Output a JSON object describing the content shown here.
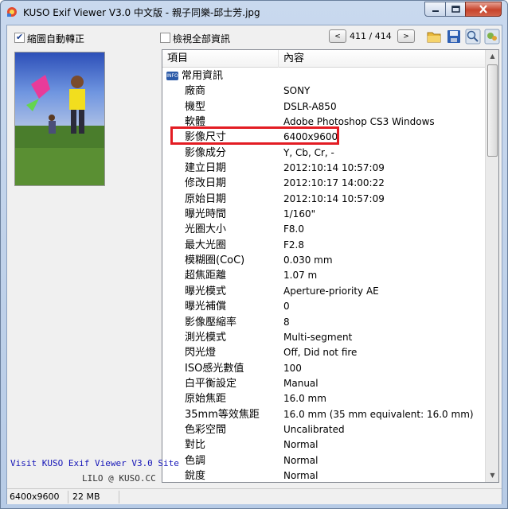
{
  "window": {
    "title": "KUSO Exif Viewer V3.0 中文版 - 親子同樂-邱士芳.jpg"
  },
  "toolbar": {
    "auto_rotate_label": "縮圖自動轉正",
    "auto_rotate_checked": "✔",
    "show_all_label": "檢視全部資訊",
    "prev_label": "<",
    "next_label": ">",
    "counter": "411 / 414"
  },
  "table": {
    "headers": [
      "項目",
      "內容"
    ],
    "group": "常用資訊",
    "rows": [
      {
        "name": "廠商",
        "value": "SONY"
      },
      {
        "name": "機型",
        "value": "DSLR-A850"
      },
      {
        "name": "軟體",
        "value": "Adobe Photoshop CS3 Windows"
      },
      {
        "name": "影像尺寸",
        "value": "6400x9600"
      },
      {
        "name": "影像成分",
        "value": "Y, Cb, Cr, -"
      },
      {
        "name": "建立日期",
        "value": "2012:10:14 10:57:09"
      },
      {
        "name": "修改日期",
        "value": "2012:10:17 14:00:22"
      },
      {
        "name": "原始日期",
        "value": "2012:10:14 10:57:09"
      },
      {
        "name": "曝光時間",
        "value": "1/160\""
      },
      {
        "name": "光圈大小",
        "value": "F8.0"
      },
      {
        "name": "最大光圈",
        "value": "F2.8"
      },
      {
        "name": "模糊圈(CoC)",
        "value": "0.030 mm"
      },
      {
        "name": "超焦距離",
        "value": "1.07 m"
      },
      {
        "name": "曝光模式",
        "value": "Aperture-priority AE"
      },
      {
        "name": "曝光補償",
        "value": "0"
      },
      {
        "name": "影像壓縮率",
        "value": "8"
      },
      {
        "name": "測光模式",
        "value": "Multi-segment"
      },
      {
        "name": "閃光燈",
        "value": "Off, Did not fire"
      },
      {
        "name": "ISO感光數值",
        "value": "100"
      },
      {
        "name": "白平衡設定",
        "value": "Manual"
      },
      {
        "name": "原始焦距",
        "value": "16.0 mm"
      },
      {
        "name": "35mm等效焦距",
        "value": "16.0 mm (35 mm equivalent: 16.0 mm)"
      },
      {
        "name": "色彩空間",
        "value": "Uncalibrated"
      },
      {
        "name": "對比",
        "value": "Normal"
      },
      {
        "name": "色調",
        "value": "Normal"
      },
      {
        "name": "銳度",
        "value": "Normal"
      }
    ]
  },
  "sidebar": {
    "site_link": "Visit KUSO Exif Viewer V3.0 Site",
    "credit": "LILO @ KUSO.CC"
  },
  "status": {
    "dimensions": "6400x9600",
    "size": "22 MB"
  },
  "colors": {
    "highlight_border": "#e31c23",
    "link": "#1717b8"
  }
}
